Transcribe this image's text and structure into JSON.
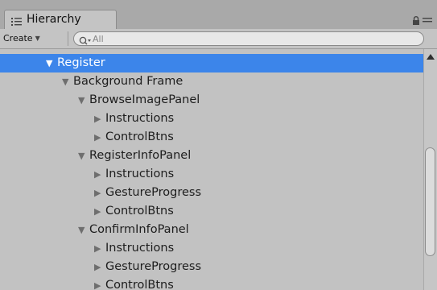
{
  "window": {
    "tab_title": "Hierarchy",
    "tab_icon": "hierarchy-list-icon",
    "tab_tools": "🔒 ≡"
  },
  "toolbar": {
    "create_label": "Create",
    "search_placeholder": "All"
  },
  "tree": {
    "rows": [
      {
        "label": "Register",
        "expanded": true,
        "selected": true,
        "depth": 0
      },
      {
        "label": "Background Frame",
        "expanded": true,
        "selected": false,
        "depth": 1
      },
      {
        "label": "BrowseImagePanel",
        "expanded": true,
        "selected": false,
        "depth": 2
      },
      {
        "label": "Instructions",
        "expanded": false,
        "selected": false,
        "depth": 3
      },
      {
        "label": "ControlBtns",
        "expanded": false,
        "selected": false,
        "depth": 3
      },
      {
        "label": "RegisterInfoPanel",
        "expanded": true,
        "selected": false,
        "depth": 2
      },
      {
        "label": "Instructions",
        "expanded": false,
        "selected": false,
        "depth": 3
      },
      {
        "label": "GestureProgress",
        "expanded": false,
        "selected": false,
        "depth": 3
      },
      {
        "label": "ControlBtns",
        "expanded": false,
        "selected": false,
        "depth": 3
      },
      {
        "label": "ConfirmInfoPanel",
        "expanded": true,
        "selected": false,
        "depth": 2
      },
      {
        "label": "Instructions",
        "expanded": false,
        "selected": false,
        "depth": 3
      },
      {
        "label": "GestureProgress",
        "expanded": false,
        "selected": false,
        "depth": 3
      },
      {
        "label": "ControlBtns",
        "expanded": false,
        "selected": false,
        "depth": 3
      }
    ]
  },
  "colors": {
    "selection": "#3c85ea",
    "panel_bg": "#c2c2c2"
  }
}
